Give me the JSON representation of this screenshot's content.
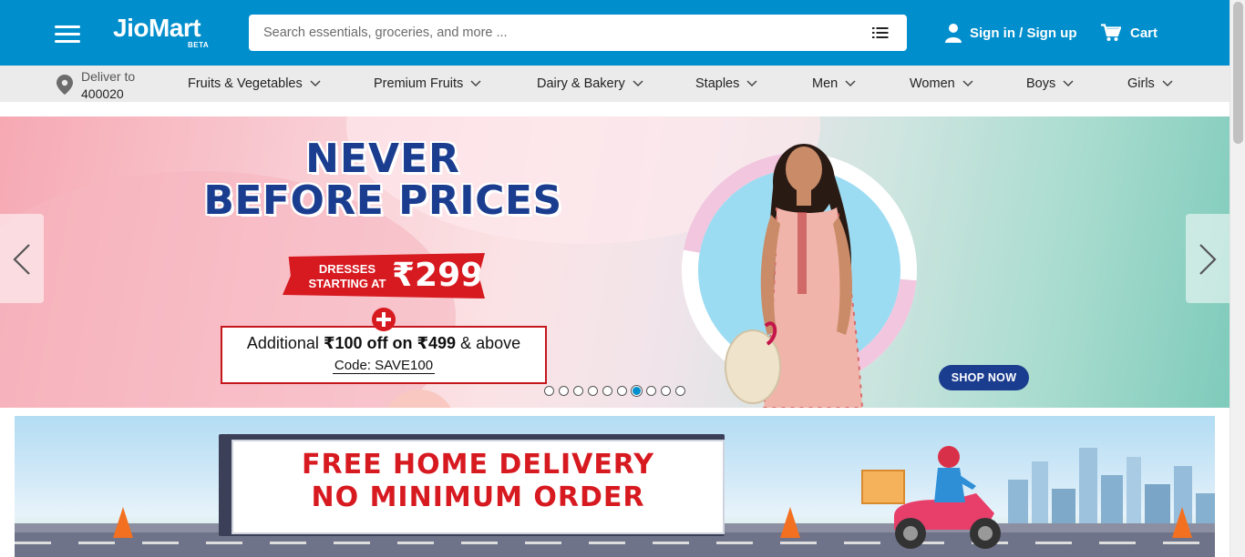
{
  "header": {
    "brand": "JioMart",
    "brand_tag": "BETA",
    "search_placeholder": "Search essentials, groceries, and more ...",
    "signin_label": "Sign in / Sign up",
    "cart_label": "Cart",
    "bg_color": "#008ecc"
  },
  "deliver": {
    "label": "Deliver to",
    "pincode": "400020"
  },
  "nav": {
    "items": [
      {
        "label": "Fruits & Vegetables"
      },
      {
        "label": "Premium Fruits"
      },
      {
        "label": "Dairy & Bakery"
      },
      {
        "label": "Staples"
      },
      {
        "label": "Men"
      },
      {
        "label": "Women"
      },
      {
        "label": "Boys"
      },
      {
        "label": "Girls"
      }
    ]
  },
  "banner": {
    "headline_line1": "NEVER",
    "headline_line2": "BEFORE PRICES",
    "tag_text_line1": "DRESSES",
    "tag_text_line2": "STARTING AT",
    "tag_price": "₹299",
    "offer_prefix": "Additional",
    "offer_amount": "₹100 off on ₹499",
    "offer_suffix": "& above",
    "offer_code": "Code: SAVE100",
    "cta": "SHOP NOW",
    "slide_count": 10,
    "active_slide": 7
  },
  "delivery_banner": {
    "line1": "FREE HOME DELIVERY",
    "line2": "NO MINIMUM ORDER"
  },
  "colors": {
    "brand_blue": "#008ecc",
    "headline_navy": "#1a3d8f",
    "offer_red": "#d71920"
  }
}
